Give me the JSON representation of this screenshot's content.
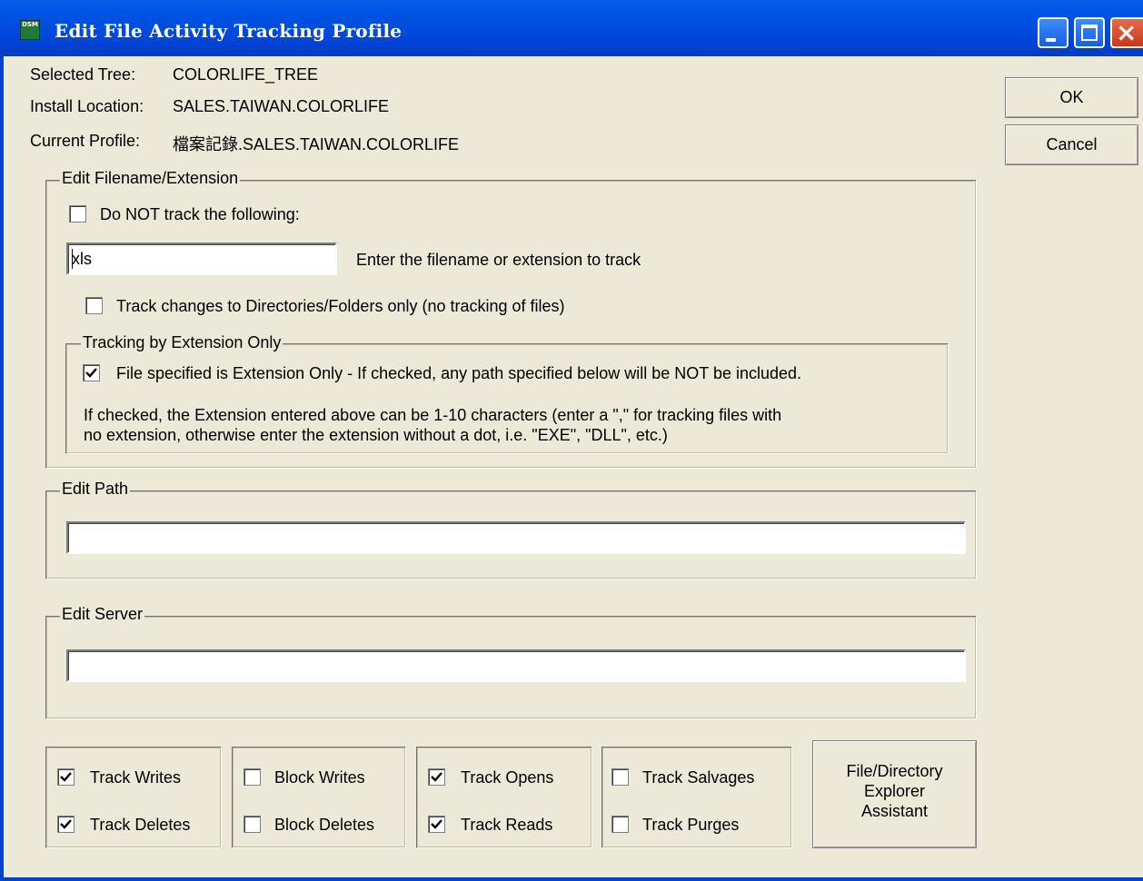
{
  "window": {
    "title": "Edit File Activity Tracking Profile",
    "icon_text": "DSM",
    "colors": {
      "titlebar": "#0055e5",
      "close": "#c7391b",
      "background": "#ece9d8"
    }
  },
  "info": {
    "selected_tree_label": "Selected Tree:",
    "selected_tree_value": "COLORLIFE_TREE",
    "install_location_label": "Install Location:",
    "install_location_value": "SALES.TAIWAN.COLORLIFE",
    "current_profile_label": "Current Profile:",
    "current_profile_value": "檔案記錄.SALES.TAIWAN.COLORLIFE"
  },
  "buttons": {
    "ok": "OK",
    "cancel": "Cancel",
    "explorer_line1": "File/Directory",
    "explorer_line2": "Explorer",
    "explorer_line3": "Assistant"
  },
  "filename_group": {
    "title": "Edit Filename/Extension",
    "do_not_track_label": "Do NOT track the following:",
    "do_not_track_checked": false,
    "filename_value": "xls",
    "filename_hint": "Enter the filename or extension to track",
    "dirs_only_label": "Track changes to Directories/Folders only (no tracking of files)",
    "dirs_only_checked": false,
    "ext_group_title": "Tracking by Extension Only",
    "ext_only_label": "File specified is Extension Only - If checked, any path specified below will be NOT be included.",
    "ext_only_checked": true,
    "ext_note_line1": "If checked, the Extension entered above can be 1-10 characters (enter a \",\" for tracking files with",
    "ext_note_line2": "no extension, otherwise enter the extension without a dot, i.e. \"EXE\", \"DLL\", etc.)"
  },
  "path_group": {
    "title": "Edit Path",
    "value": ""
  },
  "server_group": {
    "title": "Edit Server",
    "value": ""
  },
  "options": {
    "track_writes": {
      "label": "Track Writes",
      "checked": true
    },
    "track_deletes": {
      "label": "Track Deletes",
      "checked": true
    },
    "block_writes": {
      "label": "Block Writes",
      "checked": false
    },
    "block_deletes": {
      "label": "Block Deletes",
      "checked": false
    },
    "track_opens": {
      "label": "Track Opens",
      "checked": true
    },
    "track_reads": {
      "label": "Track Reads",
      "checked": true
    },
    "track_salvages": {
      "label": "Track Salvages",
      "checked": false
    },
    "track_purges": {
      "label": "Track Purges",
      "checked": false
    }
  }
}
